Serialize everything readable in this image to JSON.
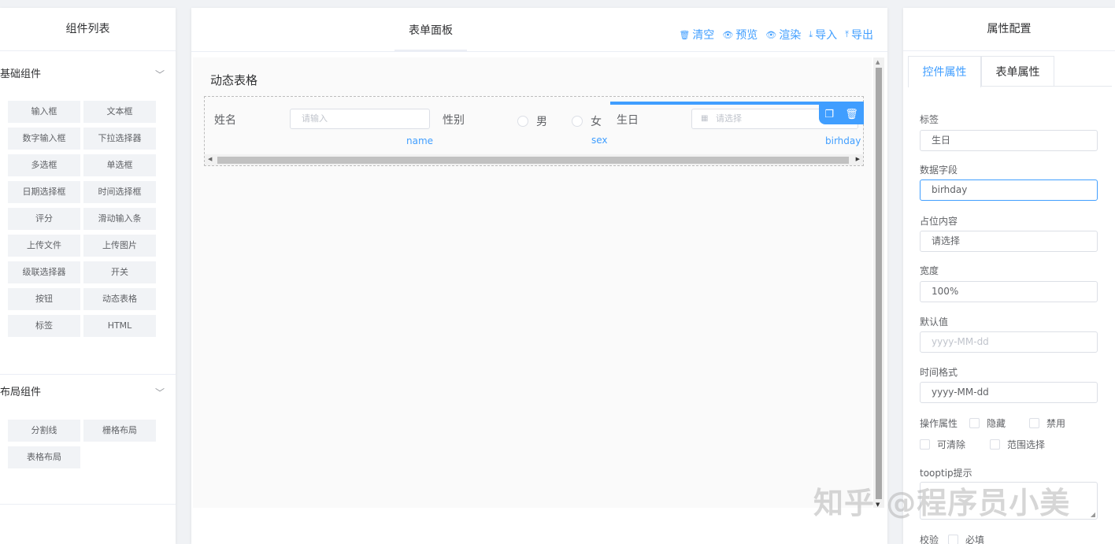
{
  "left_panel": {
    "title": "组件列表",
    "basic_group": {
      "label": "基础组件",
      "items": [
        "输入框",
        "文本框",
        "数字输入框",
        "下拉选择器",
        "多选框",
        "单选框",
        "日期选择框",
        "时间选择框",
        "评分",
        "滑动输入条",
        "上传文件",
        "上传图片",
        "级联选择器",
        "开关",
        "按钮",
        "动态表格",
        "标签",
        "HTML"
      ]
    },
    "layout_group": {
      "label": "布局组件",
      "items": [
        "分割线",
        "栅格布局",
        "表格布局"
      ]
    }
  },
  "middle_panel": {
    "title": "表单面板",
    "actions": [
      {
        "icon": "trash-icon",
        "glyph": "🗑",
        "label": "清空"
      },
      {
        "icon": "eye-icon",
        "glyph": "👁",
        "label": "预览"
      },
      {
        "icon": "eye-icon",
        "glyph": "👁",
        "label": "渲染"
      },
      {
        "icon": "download-icon",
        "glyph": "⤓",
        "label": "导入"
      },
      {
        "icon": "upload-icon",
        "glyph": "⤒",
        "label": "导出"
      }
    ],
    "dynamic_table": {
      "title": "动态表格",
      "columns": [
        {
          "label": "姓名",
          "placeholder": "请输入",
          "field": "name"
        },
        {
          "label": "性别",
          "options": [
            "男",
            "女"
          ],
          "field": "sex"
        },
        {
          "label": "生日",
          "placeholder": "请选择",
          "field": "birhday"
        }
      ]
    }
  },
  "right_panel": {
    "title": "属性配置",
    "tabs": [
      "控件属性",
      "表单属性"
    ],
    "active_tab": "控件属性",
    "fields": {
      "label_label": "标签",
      "label_value": "生日",
      "data_field_label": "数据字段",
      "data_field_value": "birhday",
      "placeholder_label": "占位内容",
      "placeholder_value": "请选择",
      "width_label": "宽度",
      "width_value": "100%",
      "default_label": "默认值",
      "default_placeholder": "yyyy-MM-dd",
      "format_label": "时间格式",
      "format_value": "yyyy-MM-dd",
      "ops_label": "操作属性",
      "ops": [
        "隐藏",
        "禁用",
        "可清除",
        "范围选择"
      ],
      "tooltip_label": "tooptip提示",
      "validate_label": "校验",
      "required_label": "必填"
    }
  },
  "watermark": "知乎 @程序员小美",
  "colors": {
    "accent": "#409eff",
    "background": "#f0f2f5",
    "component_bg": "#f1f3f6"
  }
}
